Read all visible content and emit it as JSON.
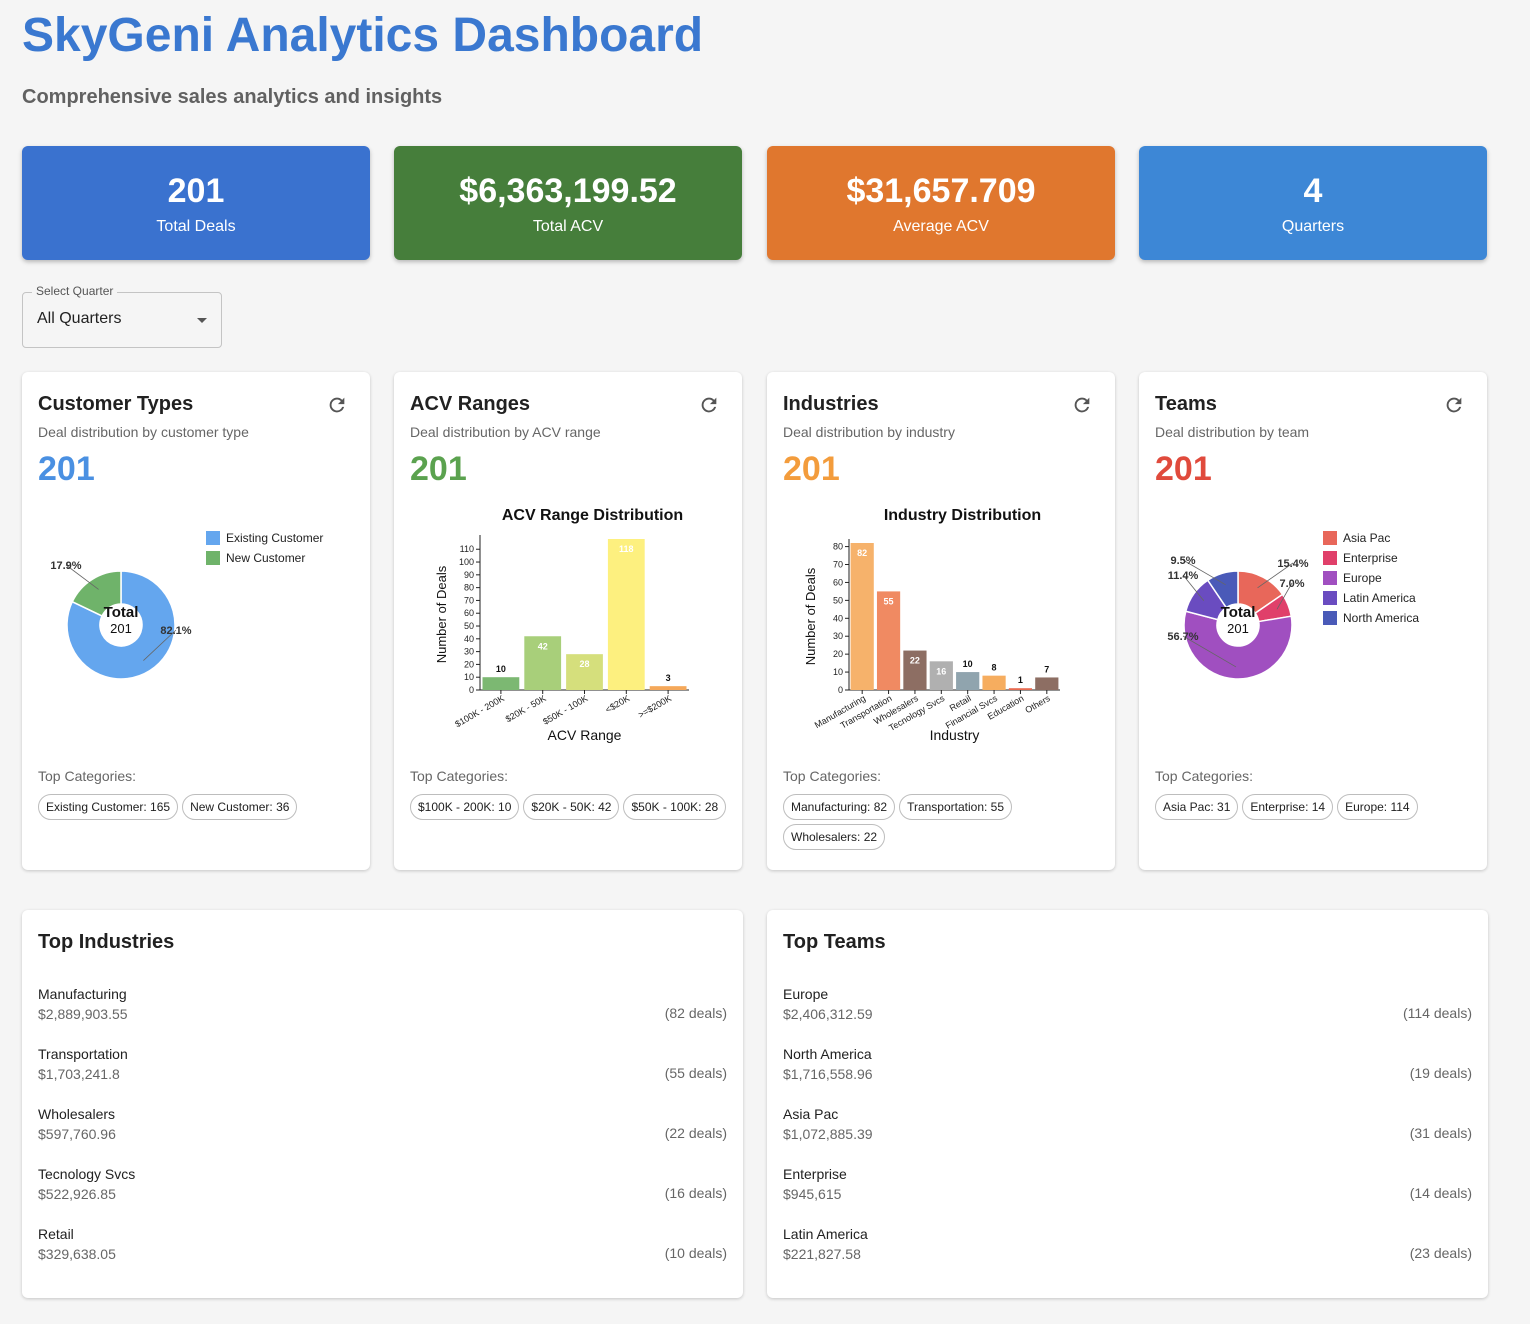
{
  "header": {
    "title": "SkyGeni Analytics Dashboard",
    "subtitle": "Comprehensive sales analytics and insights"
  },
  "stats": [
    {
      "value": "201",
      "label": "Total Deals",
      "color": "#3a72cf"
    },
    {
      "value": "$6,363,199.52",
      "label": "Total ACV",
      "color": "#467e3b"
    },
    {
      "value": "$31,657.709",
      "label": "Average ACV",
      "color": "#e0772e"
    },
    {
      "value": "4",
      "label": "Quarters",
      "color": "#3d87d6"
    }
  ],
  "filter": {
    "label": "Select Quarter",
    "value": "All Quarters"
  },
  "cards": [
    {
      "title": "Customer Types",
      "desc": "Deal distribution by customer type",
      "total": "201",
      "accent": "#4a90e2",
      "top_label": "Top Categories:",
      "chips": [
        "Existing Customer: 165",
        "New Customer: 36"
      ]
    },
    {
      "title": "ACV Ranges",
      "desc": "Deal distribution by ACV range",
      "total": "201",
      "accent": "#5ba24f",
      "top_label": "Top Categories:",
      "chips": [
        "$100K - 200K: 10",
        "$20K - 50K: 42",
        "$50K - 100K: 28"
      ]
    },
    {
      "title": "Industries",
      "desc": "Deal distribution by industry",
      "total": "201",
      "accent": "#f39c3c",
      "top_label": "Top Categories:",
      "chips": [
        "Manufacturing: 82",
        "Transportation: 55",
        "Wholesalers: 22"
      ]
    },
    {
      "title": "Teams",
      "desc": "Deal distribution by team",
      "total": "201",
      "accent": "#e04a3c",
      "top_label": "Top Categories:",
      "chips": [
        "Asia Pac: 31",
        "Enterprise: 14",
        "Europe: 114"
      ]
    }
  ],
  "chart_data": [
    {
      "type": "pie",
      "center_label": "Total",
      "center_value": "201",
      "labels": [
        "Existing Customer",
        "New Customer"
      ],
      "values": [
        165,
        36
      ],
      "percent_labels": [
        "82.1%",
        "17.9%"
      ],
      "colors": [
        "#64a6ee",
        "#6fb36a"
      ],
      "legend": "top-right"
    },
    {
      "type": "bar",
      "title": "ACV Range Distribution",
      "xlabel": "ACV Range",
      "ylabel": "Number of Deals",
      "categories": [
        "$100K - 200K",
        "$20K - 50K",
        "$50K - 100K",
        "<$20K",
        ">=$200K"
      ],
      "values": [
        10,
        42,
        28,
        118,
        3
      ],
      "colors": [
        "#7cb872",
        "#a8cf7a",
        "#d5df7c",
        "#fdf07f",
        "#f5a85a"
      ],
      "ylim": [
        0,
        118
      ],
      "yticks": [
        0,
        10,
        20,
        30,
        40,
        50,
        60,
        70,
        80,
        90,
        100,
        110
      ]
    },
    {
      "type": "bar",
      "title": "Industry Distribution",
      "xlabel": "Industry",
      "ylabel": "Number of Deals",
      "categories": [
        "Manufacturing",
        "Transportation",
        "Wholesalers",
        "Tecnology Svcs",
        "Retail",
        "Financial Svcs",
        "Education",
        "Others"
      ],
      "values": [
        82,
        55,
        22,
        16,
        10,
        8,
        1,
        7
      ],
      "colors": [
        "#f6b26b",
        "#f08a62",
        "#8d6e63",
        "#b0b0b0",
        "#90a4ae",
        "#f6ad5f",
        "#e86a50",
        "#8d6e63"
      ],
      "ylim": [
        0,
        82
      ],
      "yticks": [
        0,
        10,
        20,
        30,
        40,
        50,
        60,
        70,
        80
      ]
    },
    {
      "type": "pie",
      "center_label": "Total",
      "center_value": "201",
      "labels": [
        "Asia Pac",
        "Enterprise",
        "Europe",
        "Latin America",
        "North America"
      ],
      "values": [
        31,
        14,
        114,
        23,
        19
      ],
      "percent_labels": [
        "15.4%",
        "7.0%",
        "56.7%",
        "11.4%",
        "9.5%"
      ],
      "colors": [
        "#e8675a",
        "#e0406a",
        "#a04fc0",
        "#6a4cc0",
        "#4a5ab8"
      ],
      "legend": "top-right"
    }
  ],
  "top_industries": {
    "title": "Top Industries",
    "rows": [
      {
        "name": "Manufacturing",
        "amount": "$2,889,903.55",
        "count": "(82 deals)"
      },
      {
        "name": "Transportation",
        "amount": "$1,703,241.8",
        "count": "(55 deals)"
      },
      {
        "name": "Wholesalers",
        "amount": "$597,760.96",
        "count": "(22 deals)"
      },
      {
        "name": "Tecnology Svcs",
        "amount": "$522,926.85",
        "count": "(16 deals)"
      },
      {
        "name": "Retail",
        "amount": "$329,638.05",
        "count": "(10 deals)"
      }
    ]
  },
  "top_teams": {
    "title": "Top Teams",
    "rows": [
      {
        "name": "Europe",
        "amount": "$2,406,312.59",
        "count": "(114 deals)"
      },
      {
        "name": "North America",
        "amount": "$1,716,558.96",
        "count": "(19 deals)"
      },
      {
        "name": "Asia Pac",
        "amount": "$1,072,885.39",
        "count": "(31 deals)"
      },
      {
        "name": "Enterprise",
        "amount": "$945,615",
        "count": "(14 deals)"
      },
      {
        "name": "Latin America",
        "amount": "$221,827.58",
        "count": "(23 deals)"
      }
    ]
  }
}
